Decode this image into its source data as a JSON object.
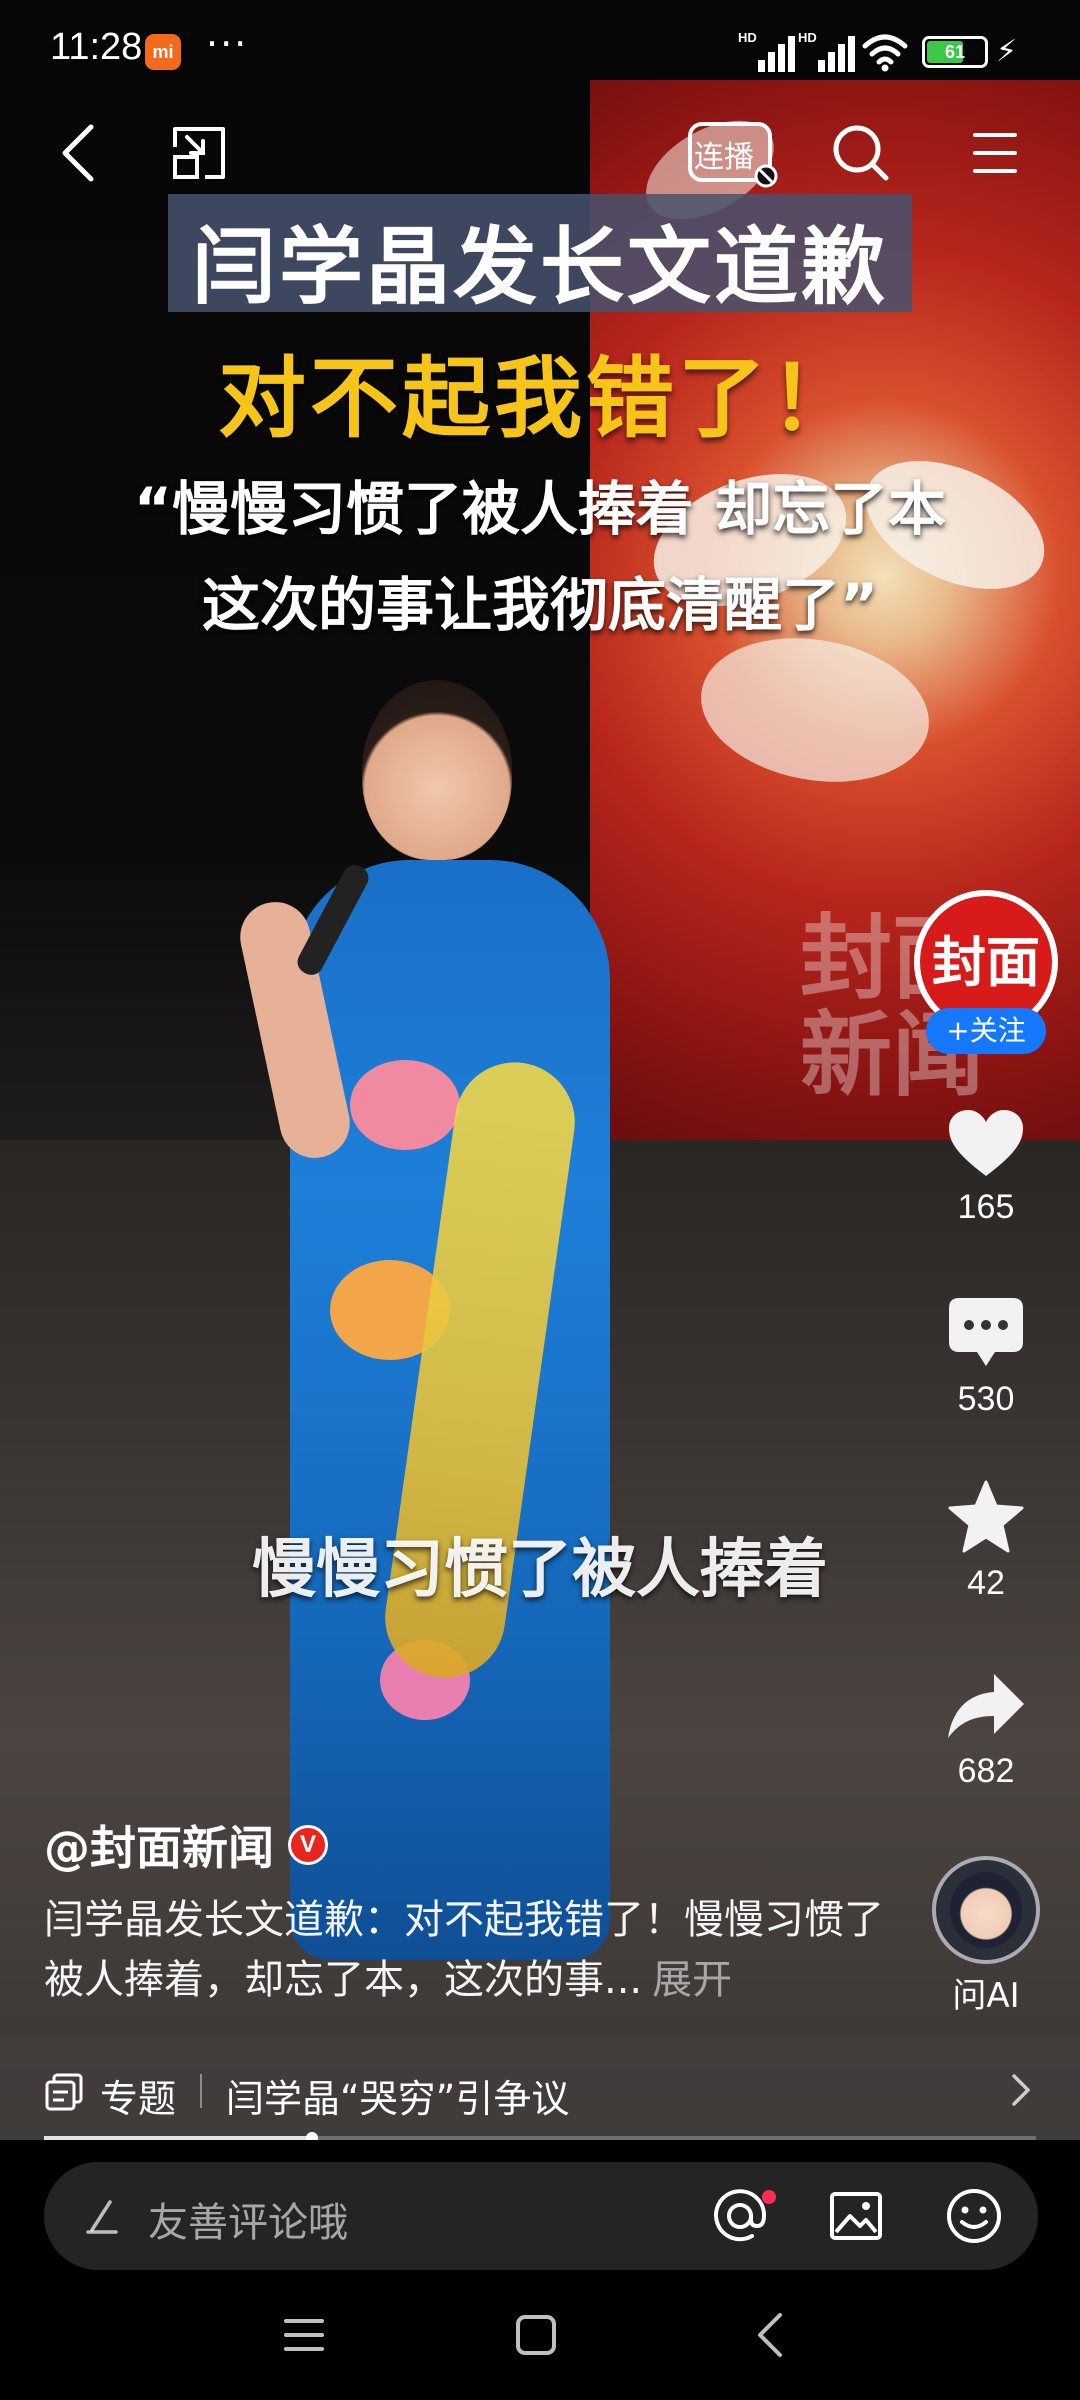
{
  "status_bar": {
    "time": "11:28",
    "mi_badge": "mi",
    "more": "···",
    "sim1_label": "HD",
    "sim2_label": "HD",
    "battery": "61"
  },
  "top_nav": {
    "cast_label": "连播"
  },
  "video_overlay": {
    "headline": "闫学晶发长文道歉",
    "subhead": "对不起我错了！",
    "quote_line1": "“慢慢习惯了被人捧着 却忘了本",
    "quote_line2": "这次的事让我彻底清醒了”",
    "caption": "慢慢习惯了被人捧着",
    "backdrop_text": "封面新闻"
  },
  "author": {
    "avatar_text": "封面",
    "follow_label": "+关注",
    "name": "@封面新闻",
    "verified_badge": "V"
  },
  "actions": {
    "likes": "165",
    "comments": "530",
    "favorites": "42",
    "shares": "682",
    "ai_label": "问AI"
  },
  "description": {
    "text": "闫学晶发长文道歉：对不起我错了！慢慢习惯了被人捧着，却忘了本，这次的事...",
    "expand_label": "展开"
  },
  "topic": {
    "label": "专题",
    "title": "闫学晶“哭穷”引争议"
  },
  "progress": {
    "fraction": 0.27
  },
  "comment_bar": {
    "placeholder": "友善评论哦"
  },
  "colors": {
    "accent_blue": "#1677ff",
    "headline_yellow": "#f7c51a",
    "brand_red": "#d71a1a",
    "battery_green": "#3cc749"
  },
  "icons": [
    "back-icon",
    "minimize-window-icon",
    "cast-icon",
    "search-icon",
    "menu-icon",
    "heart-icon",
    "comment-icon",
    "star-icon",
    "share-icon",
    "topic-icon",
    "chevron-right-icon",
    "pen-icon",
    "at-icon",
    "image-icon",
    "emoji-icon",
    "recents-icon",
    "home-icon",
    "back-nav-icon"
  ]
}
